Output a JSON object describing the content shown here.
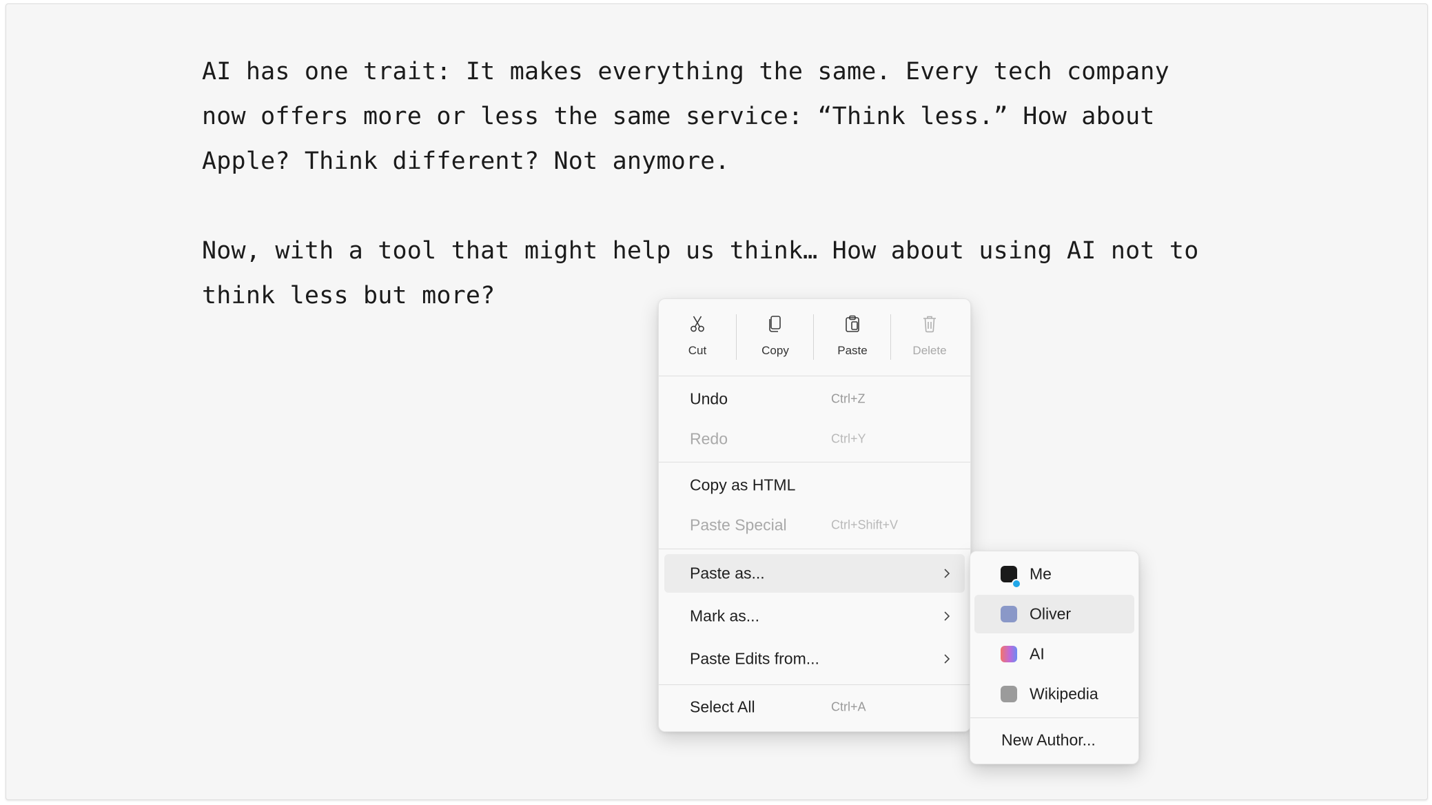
{
  "document": {
    "paragraphs": [
      "AI has one trait: It makes everything the same. Every tech company now offers more or less the same service: “Think less.” How about Apple? Think different? Not anymore.",
      "Now, with a tool that might help us think… How about using AI not to think less but more?"
    ]
  },
  "context_menu": {
    "toolbar": {
      "cut": {
        "label": "Cut",
        "icon": "scissors-icon"
      },
      "copy": {
        "label": "Copy",
        "icon": "copy-icon"
      },
      "paste": {
        "label": "Paste",
        "icon": "clipboard-icon"
      },
      "delete": {
        "label": "Delete",
        "icon": "trash-icon",
        "disabled": true
      }
    },
    "undo": {
      "label": "Undo",
      "shortcut": "Ctrl+Z"
    },
    "redo": {
      "label": "Redo",
      "shortcut": "Ctrl+Y",
      "disabled": true
    },
    "copy_html": {
      "label": "Copy as HTML"
    },
    "paste_special": {
      "label": "Paste Special",
      "shortcut": "Ctrl+Shift+V",
      "disabled": true
    },
    "paste_as": {
      "label": "Paste as...",
      "highlighted": true
    },
    "mark_as": {
      "label": "Mark as..."
    },
    "paste_edits": {
      "label": "Paste Edits from..."
    },
    "select_all": {
      "label": "Select All",
      "shortcut": "Ctrl+A"
    }
  },
  "submenu": {
    "authors": [
      {
        "label": "Me",
        "color": "#1a1a1a",
        "badge_color": "#21a7e8"
      },
      {
        "label": "Oliver",
        "color": "#8a98c8",
        "highlighted": true
      },
      {
        "label": "AI",
        "color_gradient": [
          "#f2746b",
          "#c06ad8",
          "#6a8cf2"
        ]
      },
      {
        "label": "Wikipedia",
        "color": "#9b9b9b"
      }
    ],
    "new_author": "New Author..."
  }
}
